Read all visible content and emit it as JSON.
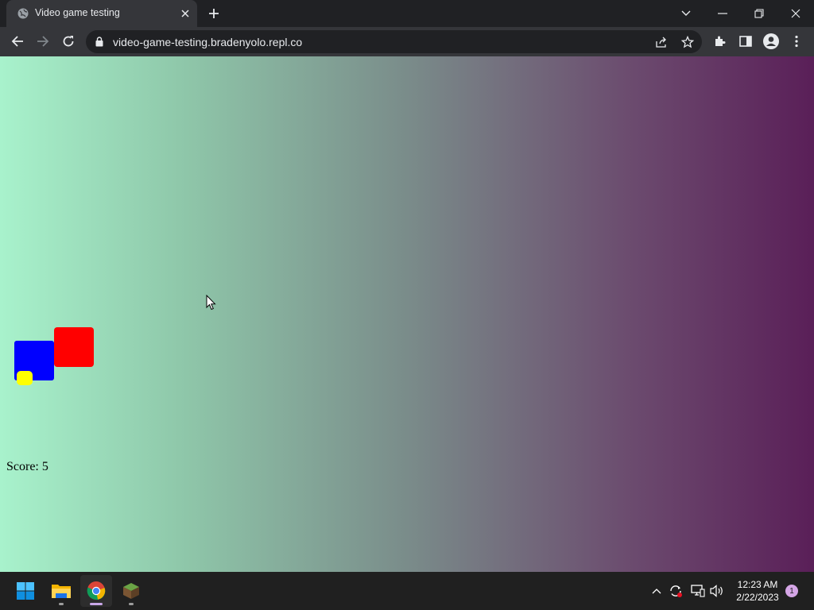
{
  "browser": {
    "tab": {
      "title": "Video game testing"
    },
    "omnibox": {
      "url": "video-game-testing.bradenyolo.repl.co"
    }
  },
  "game": {
    "score_label": "Score: 5",
    "colors": {
      "player": "#0000ff",
      "enemy": "#ff0000",
      "coin": "#ffff00"
    }
  },
  "taskbar": {
    "apps": [
      "start",
      "file-explorer",
      "chrome",
      "minecraft"
    ],
    "clock": {
      "time": "12:23 AM",
      "date": "2/22/2023"
    },
    "notification_count": "1"
  }
}
